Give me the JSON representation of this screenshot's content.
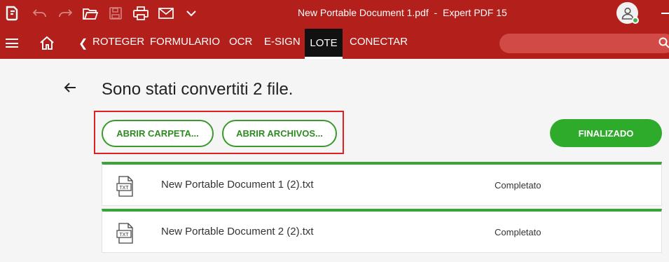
{
  "app": {
    "window_title": "New Portable Document 1.pdf  -  Expert PDF 15"
  },
  "toolbar": {
    "icons": [
      "app-logo-icon",
      "undo-icon",
      "redo-icon",
      "open-folder-icon",
      "save-icon",
      "print-icon",
      "mail-icon",
      "chevron-down-icon"
    ]
  },
  "ribbon": {
    "tabs": [
      {
        "label": "ROTEGER"
      },
      {
        "label": "FORMULARIO"
      },
      {
        "label": "OCR"
      },
      {
        "label": "E-SIGN"
      },
      {
        "label": "LOTE"
      },
      {
        "label": "CONECTAR"
      }
    ],
    "active_tab": "LOTE"
  },
  "main": {
    "title": "Sono stati convertiti 2 file.",
    "buttons": {
      "open_folder": "ABRIR CARPETA...",
      "open_files": "ABRIR ARCHIVOS...",
      "finish": "FINALIZADO"
    },
    "files": [
      {
        "type": "TXT",
        "name": "New Portable Document 1 (2).txt",
        "status": "Completato"
      },
      {
        "type": "TXT",
        "name": "New Portable Document 2 (2).txt",
        "status": "Completato"
      }
    ]
  },
  "colors": {
    "brand_red": "#b3201b",
    "accent_green": "#2eab2b",
    "highlight_red": "#e02020"
  }
}
